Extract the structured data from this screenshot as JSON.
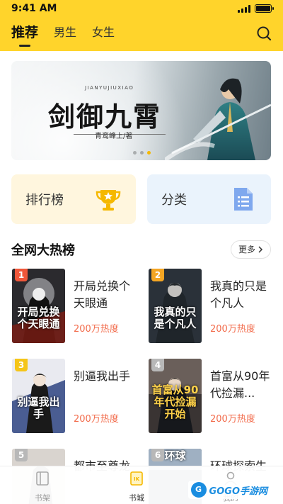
{
  "status": {
    "time": "9:41 AM"
  },
  "header": {
    "tabs": [
      {
        "label": "推荐",
        "active": true
      },
      {
        "label": "男生",
        "active": false
      },
      {
        "label": "女生",
        "active": false
      }
    ],
    "search_icon": "search-icon"
  },
  "banner": {
    "pinyin": "JIANYUJIUXIAO",
    "title": "剑御九霄",
    "author": "青鸾峰上/著",
    "page_count": 3,
    "active_page": 3
  },
  "quick_entries": [
    {
      "label": "排行榜",
      "icon": "trophy-icon",
      "bg": "#FFF6DE"
    },
    {
      "label": "分类",
      "icon": "document-list-icon",
      "bg": "#EAF3FC"
    }
  ],
  "hot_section": {
    "title": "全网大热榜",
    "more_label": "更多"
  },
  "books": [
    {
      "rank": "1",
      "title": "开局兑换个天眼通",
      "heat": "200万热度",
      "cover_text": "开局兑换个天眼通",
      "badge_color": "#F0573A"
    },
    {
      "rank": "2",
      "title": "我真的只是个凡人",
      "heat": "200万热度",
      "cover_text": "我真的只是个凡人",
      "badge_color": "#F5A623"
    },
    {
      "rank": "3",
      "title": "别逼我出手",
      "heat": "200万热度",
      "cover_text": "别逼我出手",
      "badge_color": "#F5C518"
    },
    {
      "rank": "4",
      "title": "首富从90年代捡漏...",
      "heat": "200万热度",
      "cover_text": "首富从90年代捡漏开始",
      "badge_color": "#B8B8B8"
    },
    {
      "rank": "5",
      "title": "都市至尊龙",
      "heat": "",
      "cover_text": "",
      "badge_color": "#B8B8B8"
    },
    {
      "rank": "6",
      "title": "环球探索生",
      "heat": "",
      "cover_text": "环球",
      "badge_color": "#B8B8B8"
    }
  ],
  "bottom_nav": [
    {
      "label": "书架",
      "icon": "bookshelf-icon",
      "active": false
    },
    {
      "label": "书城",
      "icon": "bookstore-icon",
      "active": true
    },
    {
      "label": "我的",
      "icon": "profile-icon",
      "active": false
    }
  ],
  "watermark": {
    "logo": "G",
    "text": "GOGO手游网"
  },
  "colors": {
    "accent": "#FFD42B",
    "heat": "#F26B4B"
  }
}
